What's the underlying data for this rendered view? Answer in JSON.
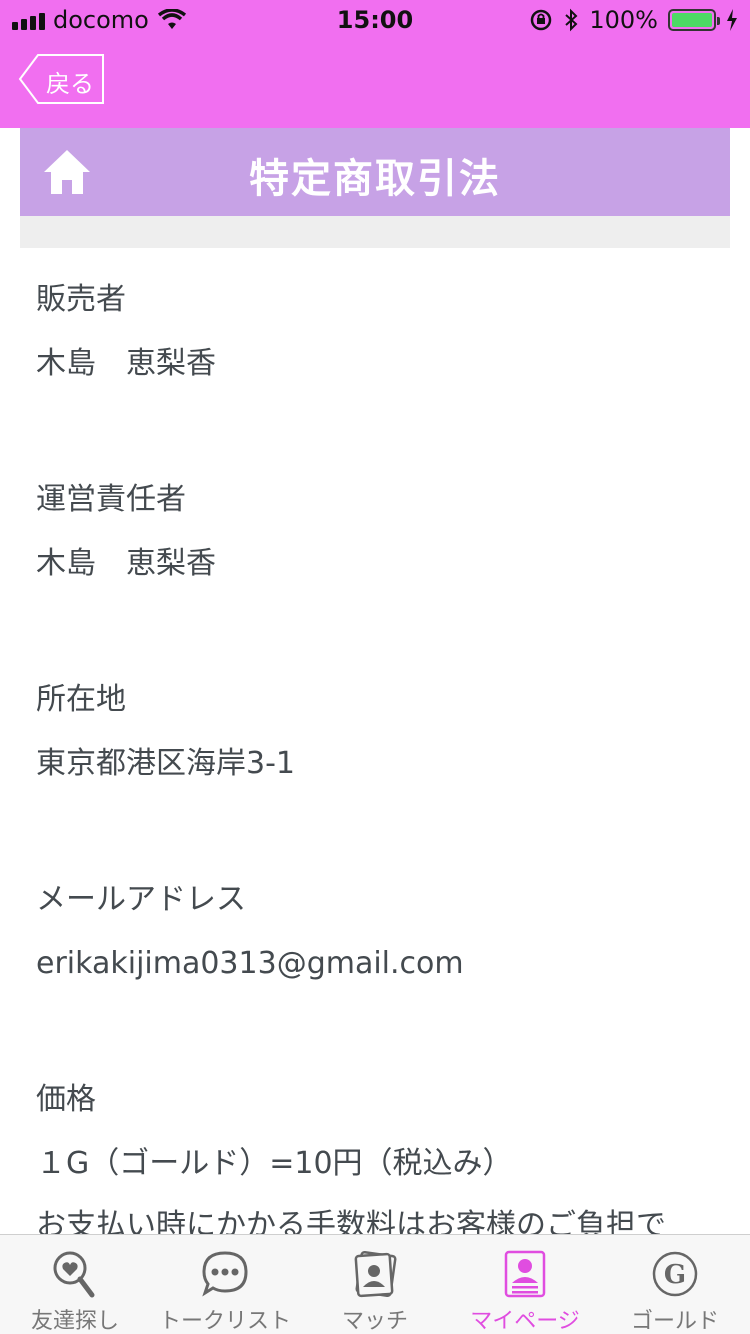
{
  "status_bar": {
    "carrier": "docomo",
    "time": "15:00",
    "battery": "100%",
    "battery_level": 1.0
  },
  "nav": {
    "back_label": "戻る"
  },
  "header": {
    "title": "特定商取引法"
  },
  "sections": [
    {
      "label": "販売者",
      "value": "木島　恵梨香"
    },
    {
      "label": "運営責任者",
      "value": "木島　恵梨香"
    },
    {
      "label": "所在地",
      "value": "東京都港区海岸3-1"
    },
    {
      "label": "メールアドレス",
      "value": "erikakijima0313@gmail.com"
    },
    {
      "label": "価格",
      "value": "１G（ゴールド）=10円（税込み）",
      "extra": "お支払い時にかかる手数料はお客様のご負担で"
    }
  ],
  "tabs": [
    {
      "label": "友達探し",
      "icon": "heart-search-icon",
      "active": false
    },
    {
      "label": "トークリスト",
      "icon": "chat-bubble-icon",
      "active": false
    },
    {
      "label": "マッチ",
      "icon": "match-cards-icon",
      "active": false
    },
    {
      "label": "マイページ",
      "icon": "profile-card-icon",
      "active": true
    },
    {
      "label": "ゴールド",
      "icon": "gold-coin-icon",
      "active": false
    }
  ],
  "colors": {
    "nav_background": "#f16ff0",
    "header_background": "#c7a2e6",
    "active_tab": "#e04de0",
    "text": "#444a4f"
  }
}
